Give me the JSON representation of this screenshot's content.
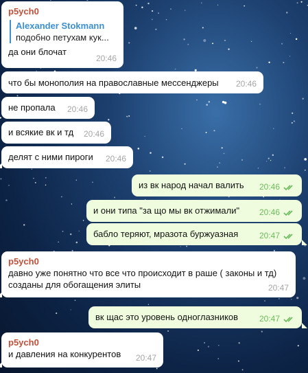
{
  "colors": {
    "incoming_bubble": "#ffffff",
    "outgoing_bubble": "#effdde",
    "sender_name": "#c0503a",
    "quote_accent": "#3c8fd0",
    "time_incoming": "#a6a6a6",
    "time_outgoing": "#6cbb5c"
  },
  "messages": [
    {
      "sender": "p5ych0",
      "reply": {
        "author": "Alexander Stokmann",
        "text": "подобно петухам кук..."
      },
      "text": "да они блочат",
      "time": "20:46",
      "direction": "in"
    },
    {
      "text": "что бы монополия на православные мессенджеры",
      "time": "20:46",
      "direction": "in"
    },
    {
      "text": "не пропала",
      "time": "20:46",
      "direction": "in"
    },
    {
      "text": "и всякие вк и тд",
      "time": "20:46",
      "direction": "in"
    },
    {
      "text": "делят с ними пироги",
      "time": "20:46",
      "direction": "in"
    },
    {
      "text": "из вк народ начал валить",
      "time": "20:46",
      "direction": "out",
      "status_icon": "double-check-icon"
    },
    {
      "text": "и они типа \"за що мы вк отжимали\"",
      "time": "20:46",
      "direction": "out",
      "status_icon": "double-check-icon"
    },
    {
      "text": "бабло теряют, мразота буржуазная",
      "time": "20:47",
      "direction": "out",
      "status_icon": "double-check-icon"
    },
    {
      "sender": "p5ych0",
      "text_lines": [
        "давно уже понятно что все что происходит в раше ( законы и тд)",
        "созданы для обогащения элиты"
      ],
      "time": "20:47",
      "direction": "in"
    },
    {
      "text": "вк щас это уровень одноглазников",
      "time": "20:47",
      "direction": "out",
      "status_icon": "double-check-icon"
    },
    {
      "sender": "p5ych0",
      "text": "и давления на конкурентов",
      "time": "20:47",
      "direction": "in"
    }
  ]
}
